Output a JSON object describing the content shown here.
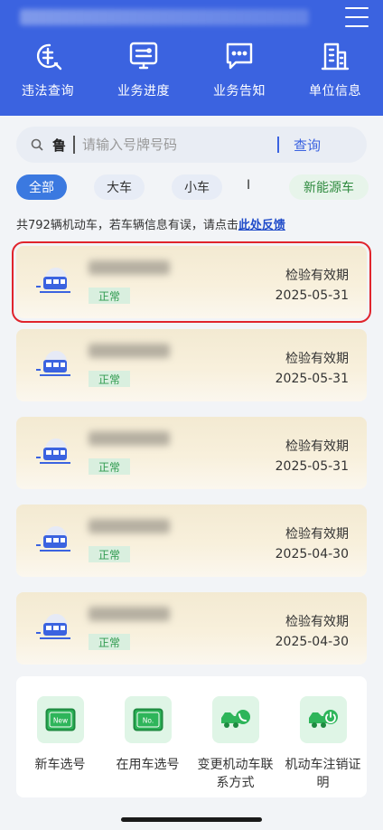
{
  "header": {
    "menu_icon": "hamburger-menu-icon",
    "quick_links": [
      {
        "label": "违法查询",
        "icon": "violation-query-icon"
      },
      {
        "label": "业务进度",
        "icon": "monitor-progress-icon"
      },
      {
        "label": "业务告知",
        "icon": "chat-notice-icon"
      },
      {
        "label": "单位信息",
        "icon": "building-info-icon"
      }
    ]
  },
  "search": {
    "province": "鲁",
    "placeholder": "请输入号牌号码",
    "button": "查询"
  },
  "filters": {
    "all": "全部",
    "large": "大车",
    "small": "小车",
    "separator": "I",
    "new_energy": "新能源车"
  },
  "summary": {
    "text": "共792辆机动车，若车辆信息有误，请点击",
    "link": "此处反馈"
  },
  "vehicles": [
    {
      "status": "正常",
      "validity_label": "检验有效期",
      "date": "2025-05-31",
      "selected": true
    },
    {
      "status": "正常",
      "validity_label": "检验有效期",
      "date": "2025-05-31"
    },
    {
      "status": "正常",
      "validity_label": "检验有效期",
      "date": "2025-05-31"
    },
    {
      "status": "正常",
      "validity_label": "检验有效期",
      "date": "2025-04-30"
    },
    {
      "status": "正常",
      "validity_label": "检验有效期",
      "date": "2025-04-30"
    }
  ],
  "services": [
    {
      "label": "新车选号",
      "icon": "new-plate-icon"
    },
    {
      "label": "在用车选号",
      "icon": "no-plate-icon"
    },
    {
      "label": "变更机动车联系方式",
      "icon": "truck-phone-icon"
    },
    {
      "label": "机动车注销证明",
      "icon": "truck-cancel-icon"
    }
  ],
  "colors": {
    "brand": "#3b63e0",
    "status_green": "#2e9a4e",
    "highlight": "#e0242c"
  }
}
